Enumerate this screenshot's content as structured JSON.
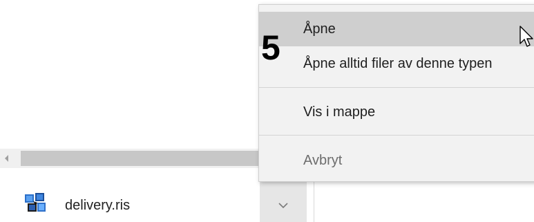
{
  "context_menu": {
    "items": [
      {
        "label": "Åpne",
        "highlighted": true
      },
      {
        "label": "Åpne alltid filer av denne typen",
        "highlighted": false
      },
      {
        "label": "Vis i mappe",
        "highlighted": false
      },
      {
        "label": "Avbryt",
        "highlighted": false,
        "disabled_look": true
      }
    ]
  },
  "step_marker": "5",
  "download": {
    "file_name": "delivery.ris",
    "icon": "ris-file-icon",
    "menu_button_icon": "chevron-down-icon"
  },
  "colors": {
    "menu_background": "#f2f2f2",
    "menu_highlight": "#cfcfcf",
    "chevron_button_bg": "#e6e6e6",
    "scrollbar_thumb": "#c7c7c7"
  }
}
